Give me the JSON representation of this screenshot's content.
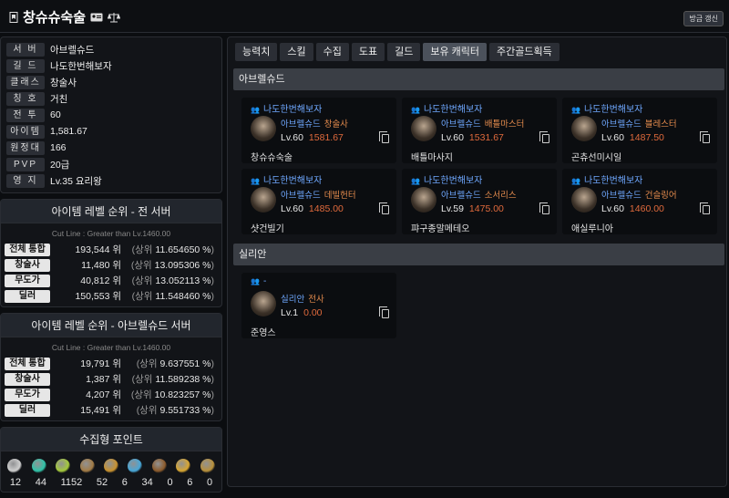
{
  "header": {
    "title": "창슈슈숙술",
    "refresh_label": "방금 갱신"
  },
  "profile": [
    {
      "label": "서 버",
      "value": "아브렐슈드"
    },
    {
      "label": "길 드",
      "value": "나도한번해보자"
    },
    {
      "label": "클래스",
      "value": "창술사"
    },
    {
      "label": "칭 호",
      "value": "거친"
    },
    {
      "label": "전 투",
      "value": "60"
    },
    {
      "label": "아이템",
      "value": "1,581.67"
    },
    {
      "label": "원정대",
      "value": "166"
    },
    {
      "label": "PVP",
      "value": "20급"
    },
    {
      "label": "영 지",
      "value": "Lv.35 요리왕"
    }
  ],
  "ranking_all": {
    "title": "아이템 레벨 순위 - 전 서버",
    "cutline": "Cut Line : Greater than Lv.1460.00",
    "rows": [
      {
        "cat": "전체 통합",
        "rank": "193,544 위",
        "pct": "11.654650 %"
      },
      {
        "cat": "창술사",
        "rank": "11,480 위",
        "pct": "13.095306 %"
      },
      {
        "cat": "무도가",
        "rank": "40,812 위",
        "pct": "13.052113 %"
      },
      {
        "cat": "딜러",
        "rank": "150,553 위",
        "pct": "11.548460 %"
      }
    ]
  },
  "ranking_server": {
    "title": "아이템 레벨 순위 - 아브렐슈드 서버",
    "cutline": "Cut Line : Greater than Lv.1460.00",
    "rows": [
      {
        "cat": "전체 통합",
        "rank": "19,791 위",
        "pct": "9.637551 %"
      },
      {
        "cat": "창술사",
        "rank": "1,387 위",
        "pct": "11.589238 %"
      },
      {
        "cat": "무도가",
        "rank": "4,207 위",
        "pct": "10.823257 %"
      },
      {
        "cat": "딜러",
        "rank": "15,491 위",
        "pct": "9.551733 %"
      }
    ]
  },
  "ranking_prefix": "(상위",
  "ranking_suffix": ")",
  "collect": {
    "title": "수집형 포인트",
    "items": [
      {
        "icon": "hand-icon",
        "color": "#cfcfcf",
        "value": "12"
      },
      {
        "icon": "globe-icon",
        "color": "#2fc3a8",
        "value": "44"
      },
      {
        "icon": "seed-icon",
        "color": "#a4c93a",
        "value": "1152"
      },
      {
        "icon": "scroll-icon",
        "color": "#a27b45",
        "value": "52"
      },
      {
        "icon": "wand-icon",
        "color": "#c9922e",
        "value": "6"
      },
      {
        "icon": "leaf-icon",
        "color": "#47a7d8",
        "value": "34"
      },
      {
        "icon": "mask-icon",
        "color": "#8b5a2b",
        "value": "0"
      },
      {
        "icon": "star-icon",
        "color": "#d8a630",
        "value": "6"
      },
      {
        "icon": "coin-icon",
        "color": "#b8903a",
        "value": "0"
      }
    ]
  },
  "tabs": [
    {
      "label": "능력치",
      "active": false
    },
    {
      "label": "스킬",
      "active": false
    },
    {
      "label": "수집",
      "active": false
    },
    {
      "label": "도표",
      "active": false
    },
    {
      "label": "길드",
      "active": false
    },
    {
      "label": "보유 캐릭터",
      "active": true
    },
    {
      "label": "주간골드획득",
      "active": false
    }
  ],
  "groups": [
    {
      "server": "아브렐슈드",
      "characters": [
        {
          "guild": "나도한번해보자",
          "server": "아브렐슈드",
          "class": "창술사",
          "level": "Lv.60",
          "item_level": "1581.67",
          "name": "창슈슈숙술"
        },
        {
          "guild": "나도한번해보자",
          "server": "아브렐슈드",
          "class": "배틀마스터",
          "level": "Lv.60",
          "item_level": "1531.67",
          "name": "배틀마사지"
        },
        {
          "guild": "나도한번해보자",
          "server": "아브렐슈드",
          "class": "블레스터",
          "level": "Lv.60",
          "item_level": "1487.50",
          "name": "곤츄선미시일"
        },
        {
          "guild": "나도한번해보자",
          "server": "아브렐슈드",
          "class": "데빌헌터",
          "level": "Lv.60",
          "item_level": "1485.00",
          "name": "샷건빌기"
        },
        {
          "guild": "나도한번해보자",
          "server": "아브렐슈드",
          "class": "소서리스",
          "level": "Lv.59",
          "item_level": "1475.00",
          "name": "퍄구종말메테오"
        },
        {
          "guild": "나도한번해보자",
          "server": "아브렐슈드",
          "class": "건슬링어",
          "level": "Lv.60",
          "item_level": "1460.00",
          "name": "애실루니아"
        }
      ]
    },
    {
      "server": "실리안",
      "characters": [
        {
          "guild": "-",
          "server": "실리안",
          "class": "전사",
          "level": "Lv.1",
          "item_level": "0.00",
          "name": "준영스"
        }
      ]
    }
  ]
}
